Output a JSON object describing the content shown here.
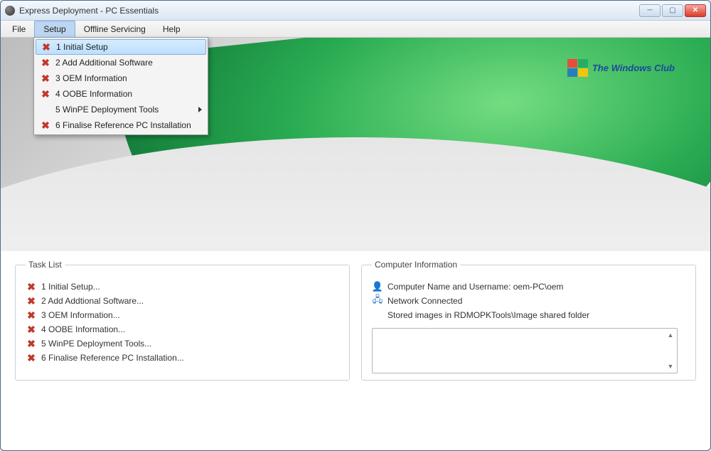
{
  "window": {
    "title": "Express Deployment - PC Essentials"
  },
  "menubar": {
    "file": "File",
    "setup": "Setup",
    "offline": "Offline Servicing",
    "help": "Help"
  },
  "setup_menu": {
    "items": [
      {
        "label": "1 Initial Setup",
        "has_x": true,
        "highlight": true,
        "submenu": false
      },
      {
        "label": "2 Add Additional Software",
        "has_x": true,
        "highlight": false,
        "submenu": false
      },
      {
        "label": "3 OEM Information",
        "has_x": true,
        "highlight": false,
        "submenu": false
      },
      {
        "label": "4 OOBE Information",
        "has_x": true,
        "highlight": false,
        "submenu": false
      },
      {
        "label": "5 WinPE Deployment Tools",
        "has_x": false,
        "highlight": false,
        "submenu": true
      },
      {
        "label": "6 Finalise Reference PC Installation",
        "has_x": true,
        "highlight": false,
        "submenu": false
      }
    ]
  },
  "logo_text": "The Windows Club",
  "task_list": {
    "legend": "Task List",
    "items": [
      "1 Initial Setup...",
      "2 Add Addtional Software...",
      "3 OEM Information...",
      "4 OOBE Information...",
      "5 WinPE Deployment Tools...",
      "6 Finalise Reference PC Installation..."
    ]
  },
  "computer_info": {
    "legend": "Computer Information",
    "name_line": "Computer Name and Username: oem-PC\\oem",
    "network_line": "Network Connected",
    "images_line": "Stored images in RDMOPKTools\\Image shared folder"
  }
}
